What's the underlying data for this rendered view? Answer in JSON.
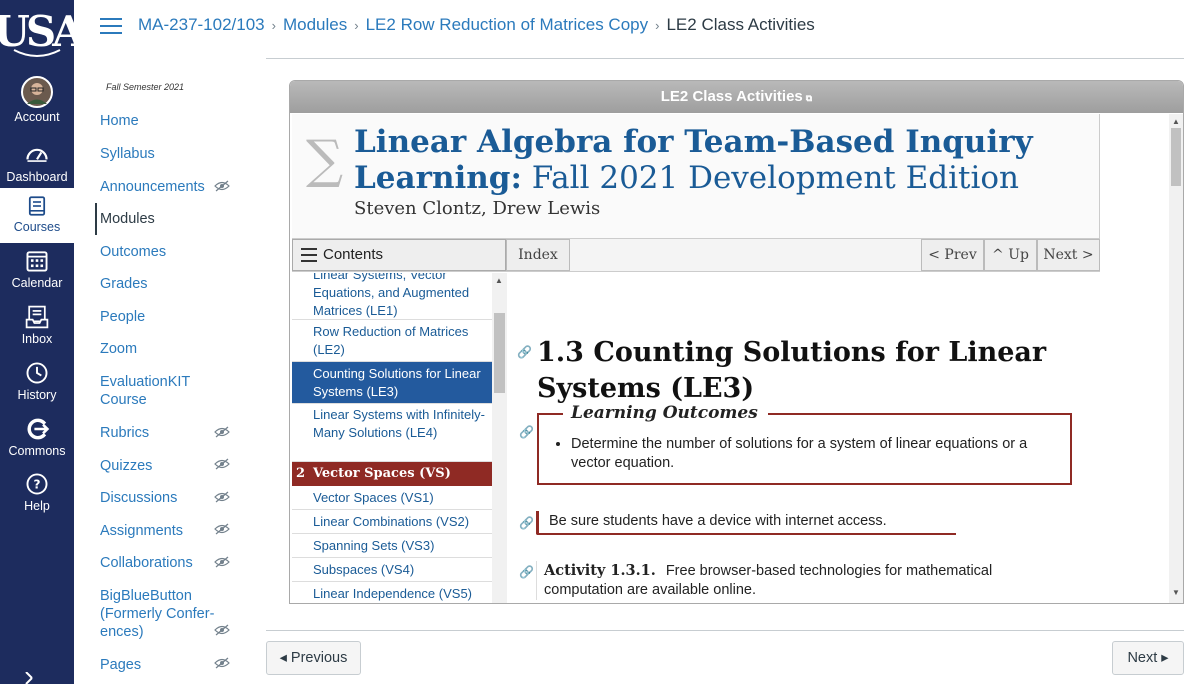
{
  "global_nav": {
    "logo_text": "USA",
    "items": [
      {
        "label": "Account",
        "icon": "avatar"
      },
      {
        "label": "Dashboard",
        "icon": "dashboard-icon"
      },
      {
        "label": "Courses",
        "icon": "courses-icon"
      },
      {
        "label": "Calendar",
        "icon": "calendar-icon"
      },
      {
        "label": "Inbox",
        "icon": "inbox-icon"
      },
      {
        "label": "History",
        "icon": "history-icon"
      },
      {
        "label": "Commons",
        "icon": "commons-icon"
      },
      {
        "label": "Help",
        "icon": "help-icon"
      }
    ],
    "active": "Courses",
    "colors": {
      "background": "#1d2c5e",
      "active_text": "#1d4b8a"
    }
  },
  "breadcrumbs": [
    "MA-237-102/103",
    "Modules",
    "LE2 Row Reduction of Matrices Copy",
    "LE2 Class Activities"
  ],
  "course_nav": {
    "term": "Fall Semester 2021",
    "items": [
      {
        "label": "Home",
        "hidden": false
      },
      {
        "label": "Syllabus",
        "hidden": false
      },
      {
        "label": "Announcements",
        "hidden": true
      },
      {
        "label": "Modules",
        "hidden": false,
        "active": true
      },
      {
        "label": "Outcomes",
        "hidden": false
      },
      {
        "label": "Grades",
        "hidden": false
      },
      {
        "label": "People",
        "hidden": false
      },
      {
        "label": "Zoom",
        "hidden": false
      },
      {
        "label": "EvaluationKIT Course",
        "hidden": false
      },
      {
        "label": "Rubrics",
        "hidden": true
      },
      {
        "label": "Quizzes",
        "hidden": true
      },
      {
        "label": "Discussions",
        "hidden": true
      },
      {
        "label": "Assignments",
        "hidden": true
      },
      {
        "label": "Collaborations",
        "hidden": true
      },
      {
        "label": "BigBlueButton (Formerly Confer-ences)",
        "hidden": true
      },
      {
        "label": "Pages",
        "hidden": true
      }
    ]
  },
  "frame": {
    "title": "LE2 Class Activities",
    "book": {
      "title_bold": "Linear Algebra for Team-Based Inquiry Learning:",
      "title_rest": "Fall 2021 Development Edition",
      "authors": "Steven Clontz, Drew Lewis"
    },
    "toolbar": {
      "contents": "Contents",
      "index": "Index",
      "prev": "< Prev",
      "up": "^ Up",
      "next": "Next >"
    },
    "toc": [
      {
        "label": "Linear Systems, Vector Equations, and Augmented Matrices (LE1)",
        "type": "entry"
      },
      {
        "label": "Row Reduction of Matrices (LE2)",
        "type": "entry"
      },
      {
        "label": "Counting Solutions for Linear Systems (LE3)",
        "type": "entry",
        "selected": true
      },
      {
        "label": "Linear Systems with Infinitely-Many Solutions (LE4)",
        "type": "entry"
      },
      {
        "num": "2",
        "label": "Vector Spaces (VS)",
        "type": "chapter"
      },
      {
        "label": "Vector Spaces (VS1)",
        "type": "entry"
      },
      {
        "label": "Linear Combinations (VS2)",
        "type": "entry"
      },
      {
        "label": "Spanning Sets (VS3)",
        "type": "entry"
      },
      {
        "label": "Subspaces (VS4)",
        "type": "entry"
      },
      {
        "label": "Linear Independence (VS5)",
        "type": "entry"
      }
    ],
    "content": {
      "heading": "1.3 Counting Solutions for Linear Systems (LE3)",
      "outcomes_title": "Learning Outcomes",
      "outcomes": [
        "Determine the number of solutions for a system of linear equations or a vector equation."
      ],
      "note": "Be sure students have a device with internet access.",
      "activity_label": "Activity 1.3.1.",
      "activity_text": "Free browser-based technologies for mathematical computation are available online."
    },
    "colors": {
      "accent": "#8f2a24",
      "title_blue": "#1a5b96",
      "selected": "#235a9e"
    }
  },
  "footer": {
    "previous": "◂ Previous",
    "next": "Next ▸"
  }
}
